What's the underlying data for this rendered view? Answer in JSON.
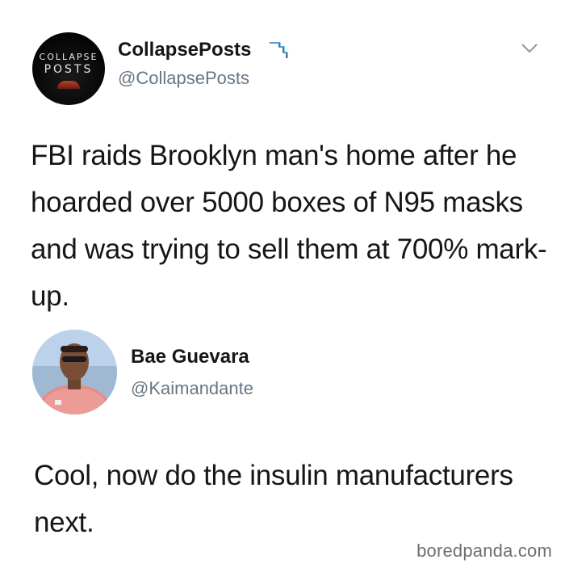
{
  "tweet": {
    "avatar": {
      "logo_line1": "COLLAPSE",
      "logo_line2": "POSTS"
    },
    "display_name": "CollapsePosts",
    "handle": "@CollapsePosts",
    "text": "FBI raids Brooklyn man's home after he hoarded over 5000 boxes of N95 masks and was trying to sell them at 700% mark-up.",
    "menu_icon": "chevron-down-icon",
    "name_icon": "downtrend-chart-icon"
  },
  "reply": {
    "display_name": "Bae Guevara",
    "handle": "@Kaimandante",
    "text": "Cool, now do the insulin manufacturers next."
  },
  "watermark": "boredpanda.com",
  "colors": {
    "text": "#14171a",
    "secondary": "#657786",
    "chart_icon": "#1da1f2",
    "watermark": "#6f6f6f"
  }
}
